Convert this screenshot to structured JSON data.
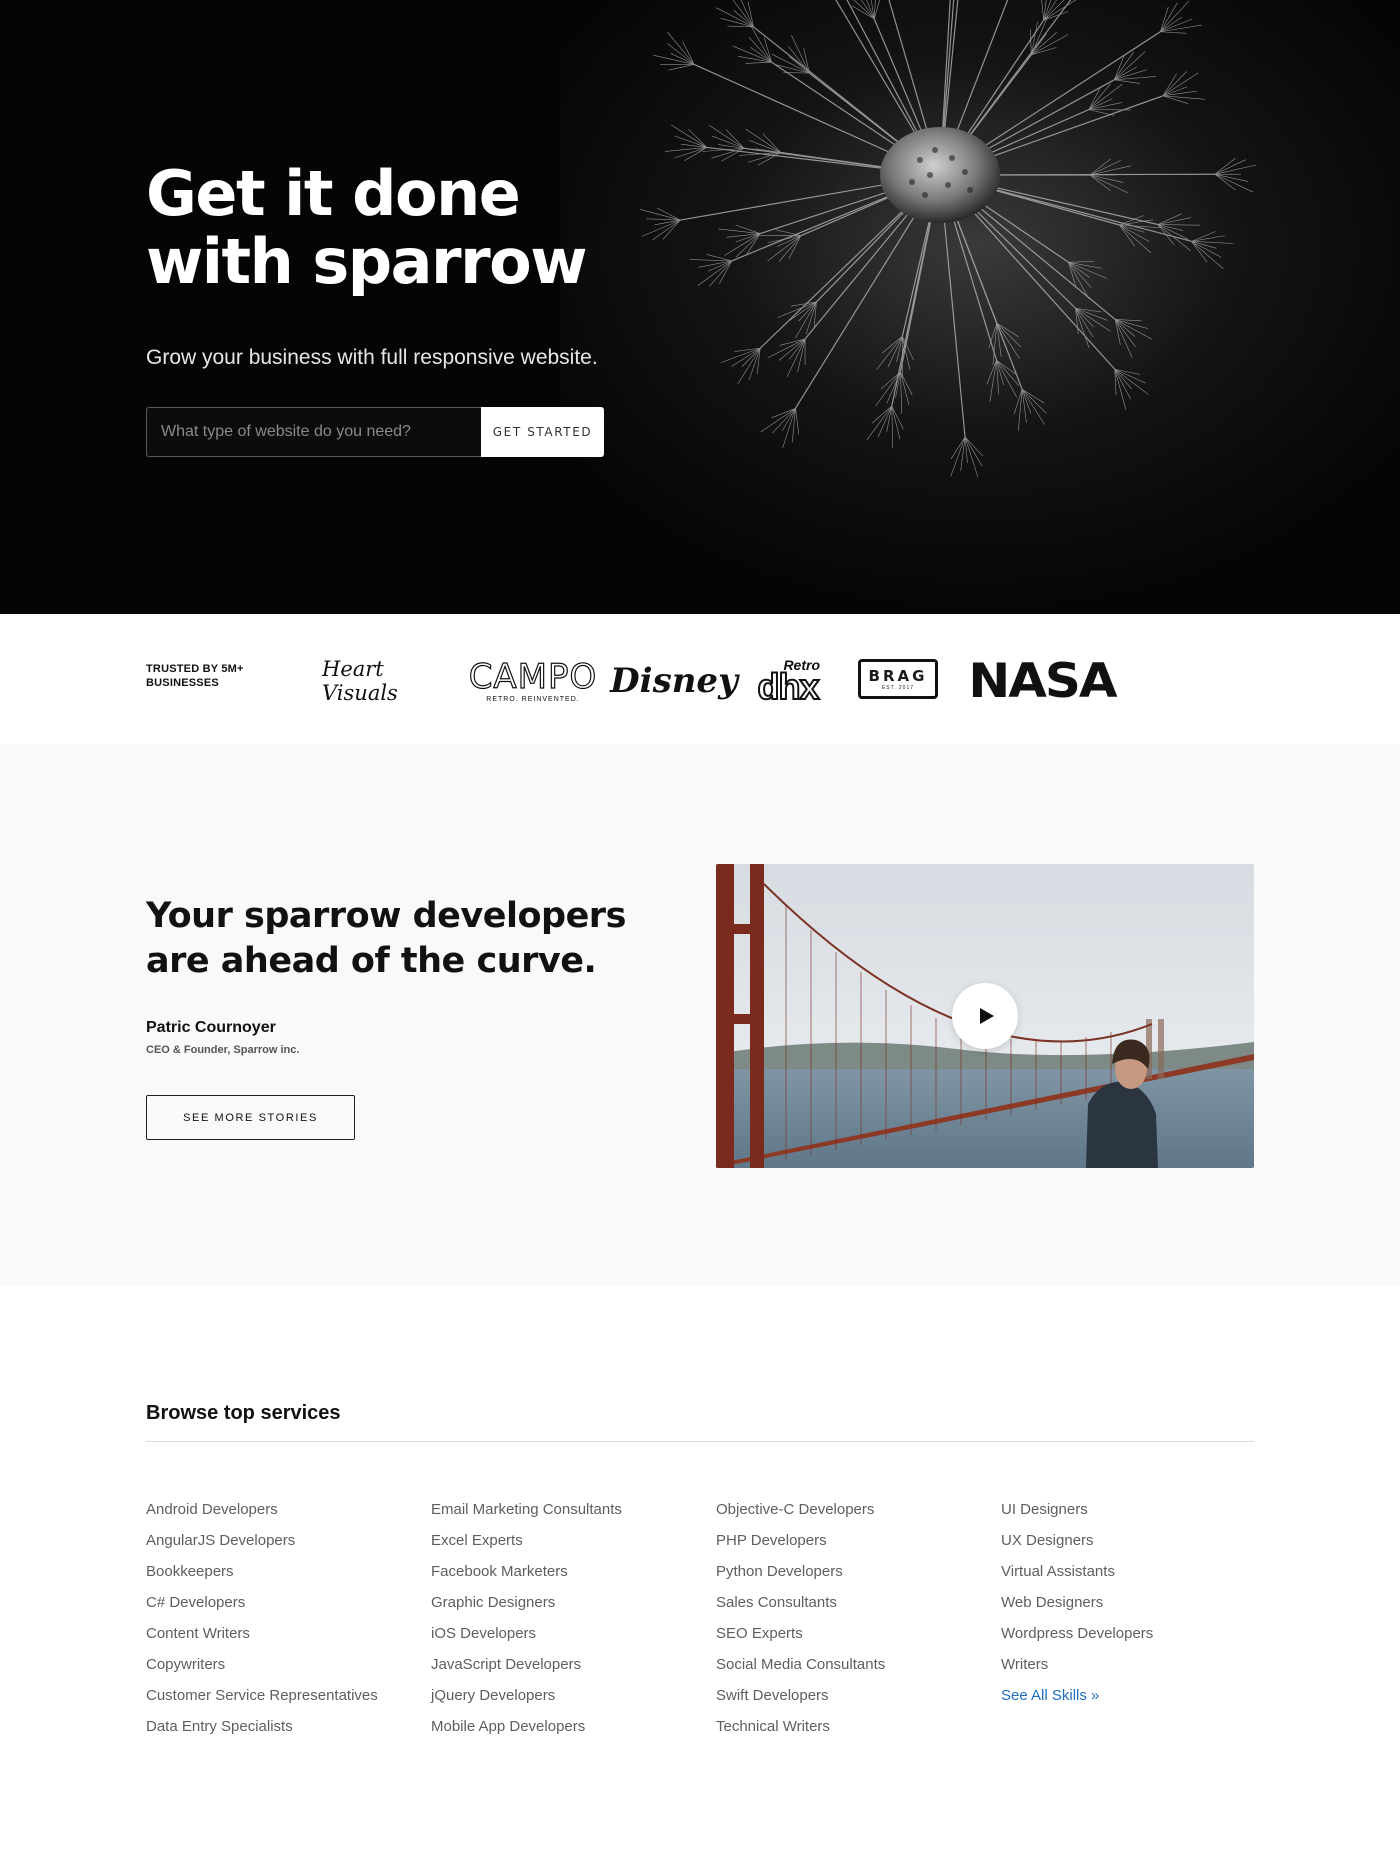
{
  "hero": {
    "title": "Get it done with sparrow",
    "subtitle": "Grow your business with full responsive website.",
    "search_placeholder": "What type of website do you need?",
    "cta_label": "GET STARTED"
  },
  "trusted": {
    "label": "TRUSTED BY 5M+ BUSINESSES",
    "logos": {
      "heart_visuals": "Heart Visuals",
      "campo": "CAMPO",
      "campo_tagline": "RETRO. REINVENTED.",
      "disney": "Disney",
      "dhx_top": "Retro",
      "dhx": "dhx",
      "brag": "BRAG",
      "brag_tag": "EST. 2017",
      "nasa": "NASA"
    }
  },
  "story": {
    "title": "Your sparrow developers are ahead of the curve.",
    "author_name": "Patric Cournoyer",
    "author_role": "CEO & Founder, Sparrow inc.",
    "cta_label": "SEE MORE STORIES"
  },
  "services": {
    "title": "Browse top services",
    "columns": [
      [
        "Android Developers",
        "AngularJS Developers",
        "Bookkeepers",
        "C# Developers",
        "Content Writers",
        "Copywriters",
        "Customer Service Representatives",
        "Data Entry Specialists"
      ],
      [
        "Email Marketing Consultants",
        "Excel Experts",
        "Facebook Marketers",
        "Graphic Designers",
        "iOS Developers",
        "JavaScript Developers",
        "jQuery Developers",
        "Mobile App Developers"
      ],
      [
        "Objective-C Developers",
        "PHP Developers",
        "Python Developers",
        "Sales Consultants",
        "SEO Experts",
        "Social Media Consultants",
        "Swift Developers",
        "Technical Writers"
      ],
      [
        "UI Designers",
        "UX Designers",
        "Virtual Assistants",
        "Web Designers",
        "Wordpress Developers",
        "Writers"
      ]
    ],
    "see_all": "See All Skills »"
  },
  "colors": {
    "hero_bg": "#050505",
    "story_bg": "#f9f9f9",
    "link": "#1f6dbf",
    "text_muted": "#5e5e5e"
  },
  "icons": {
    "play": "play-icon"
  }
}
